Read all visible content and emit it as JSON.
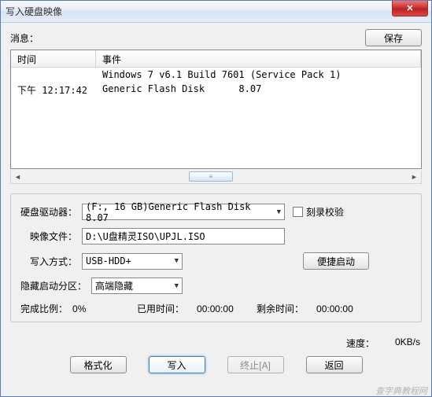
{
  "window": {
    "title": "写入硬盘映像"
  },
  "messages_section": {
    "label": "消息：",
    "save_button": "保存"
  },
  "list": {
    "headers": {
      "time": "时间",
      "event": "事件"
    },
    "rows": [
      {
        "time": "",
        "event": "Windows 7 v6.1 Build 7601 (Service Pack 1)"
      },
      {
        "time": "下午 12:17:42",
        "event": "Generic Flash Disk      8.07"
      }
    ]
  },
  "form": {
    "drive_label": "硬盘驱动器：",
    "drive_value": "(F:, 16 GB)Generic Flash Disk      8.07",
    "verify_label": "刻录校验",
    "image_label": "映像文件：",
    "image_value": "D:\\U盘精灵ISO\\UPJL.ISO",
    "write_mode_label": "写入方式：",
    "write_mode_value": "USB-HDD+",
    "quick_boot_button": "便捷启动",
    "hide_label": "隐藏启动分区：",
    "hide_value": "高端隐藏"
  },
  "status": {
    "pct_label": "完成比例：",
    "pct_value": "0%",
    "elapsed_label": "已用时间：",
    "elapsed_value": "00:00:00",
    "remain_label": "剩余时间：",
    "remain_value": "00:00:00",
    "speed_label": "速度：",
    "speed_value": "0KB/s"
  },
  "footer": {
    "format": "格式化",
    "write": "写入",
    "abort": "终止[A]",
    "back": "返回"
  },
  "watermark": "查字典教程网"
}
